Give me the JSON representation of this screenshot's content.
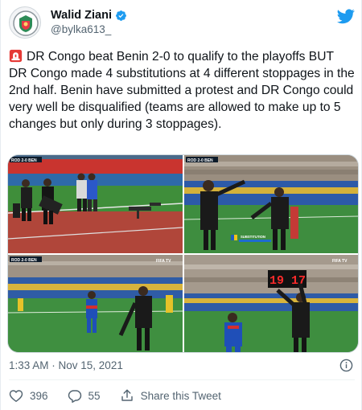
{
  "author": {
    "display_name": "Walid Ziani",
    "handle": "@bylka613_",
    "verified": true
  },
  "tweet": {
    "text": "DR Congo beat Benin 2-0 to qualify to the playoffs BUT DR Congo made 4 substitutions at 4 different stoppages in the 2nd half. Benin have submitted a protest and DR Congo could very well be disqualified (teams are allowed to make up to 5 changes but only during 3 stoppages).",
    "leading_emoji": "police-car-light-icon"
  },
  "media": {
    "photos": [
      {
        "name": "photo-touchline-substitution-board",
        "scoreboard": "ROD 2-0 BEN"
      },
      {
        "name": "photo-referee-substitution-caption",
        "scoreboard": "ROD 2-0 BEN",
        "caption": "SUBSTITUTION",
        "brand": "FIFA TV"
      },
      {
        "name": "photo-player-entering-pitch",
        "scoreboard": "ROD 2-0 BEN",
        "brand": "FIFA TV"
      },
      {
        "name": "photo-official-raising-board",
        "board_numbers": "19  17",
        "brand": "FIFA TV"
      }
    ]
  },
  "meta": {
    "timestamp": "1:33 AM · Nov 15, 2021"
  },
  "actions": {
    "likes": "396",
    "replies": "55",
    "share_label": "Share this Tweet"
  },
  "colors": {
    "text": "#0f1419",
    "secondary": "#536471",
    "twitter_blue": "#1d9bf0",
    "pitch_green": "#2f8a3a"
  }
}
